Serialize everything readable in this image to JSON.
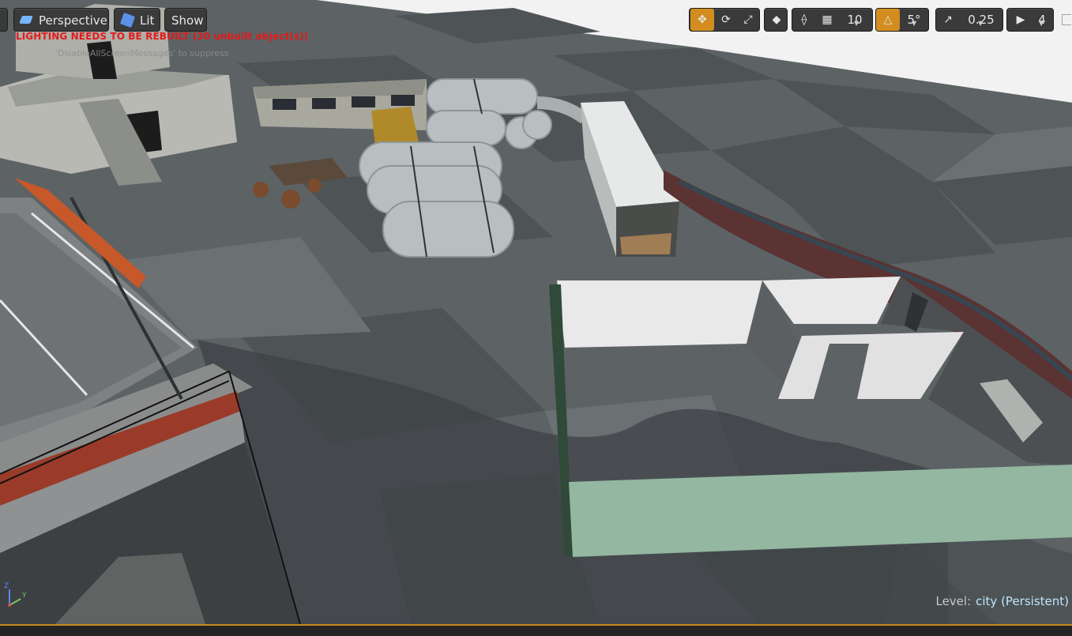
{
  "toolbar": {
    "left_partial": "",
    "perspective_label": "Perspective",
    "lit_label": "Lit",
    "show_label": "Show",
    "grid_snap_value": "10",
    "rotation_snap_value": "5°",
    "scale_snap_value": "0.25",
    "camera_speed_value": "4"
  },
  "messages": {
    "lighting_warning": "LIGHTING NEEDS TO BE REBUILT (30 unbuilt object(s))",
    "suppress_hint": "'DisableAllScreenMessages' to suppress"
  },
  "status": {
    "level_prefix": "Level:",
    "level_name": "city (Persistent)"
  },
  "axis": {
    "y_label": "Y",
    "z_label": "Z"
  },
  "colors": {
    "accent": "#d38d1f",
    "warning": "#e41a1a",
    "floor_light": "#6a6f72",
    "floor_dark": "#4f5457",
    "sky": "#f4f4f4"
  },
  "icons": {
    "perspective": "perspective-view-icon",
    "lit": "lit-mode-icon",
    "translate": "translate-icon",
    "rotate": "rotate-icon",
    "scale": "scale-icon",
    "world_local": "world-local-icon",
    "surface_snap": "surface-snap-icon",
    "grid_snap": "grid-snap-icon",
    "rotation_snap": "rotation-snap-icon",
    "scale_snap": "scale-snap-icon",
    "camera_speed": "camera-speed-icon"
  }
}
